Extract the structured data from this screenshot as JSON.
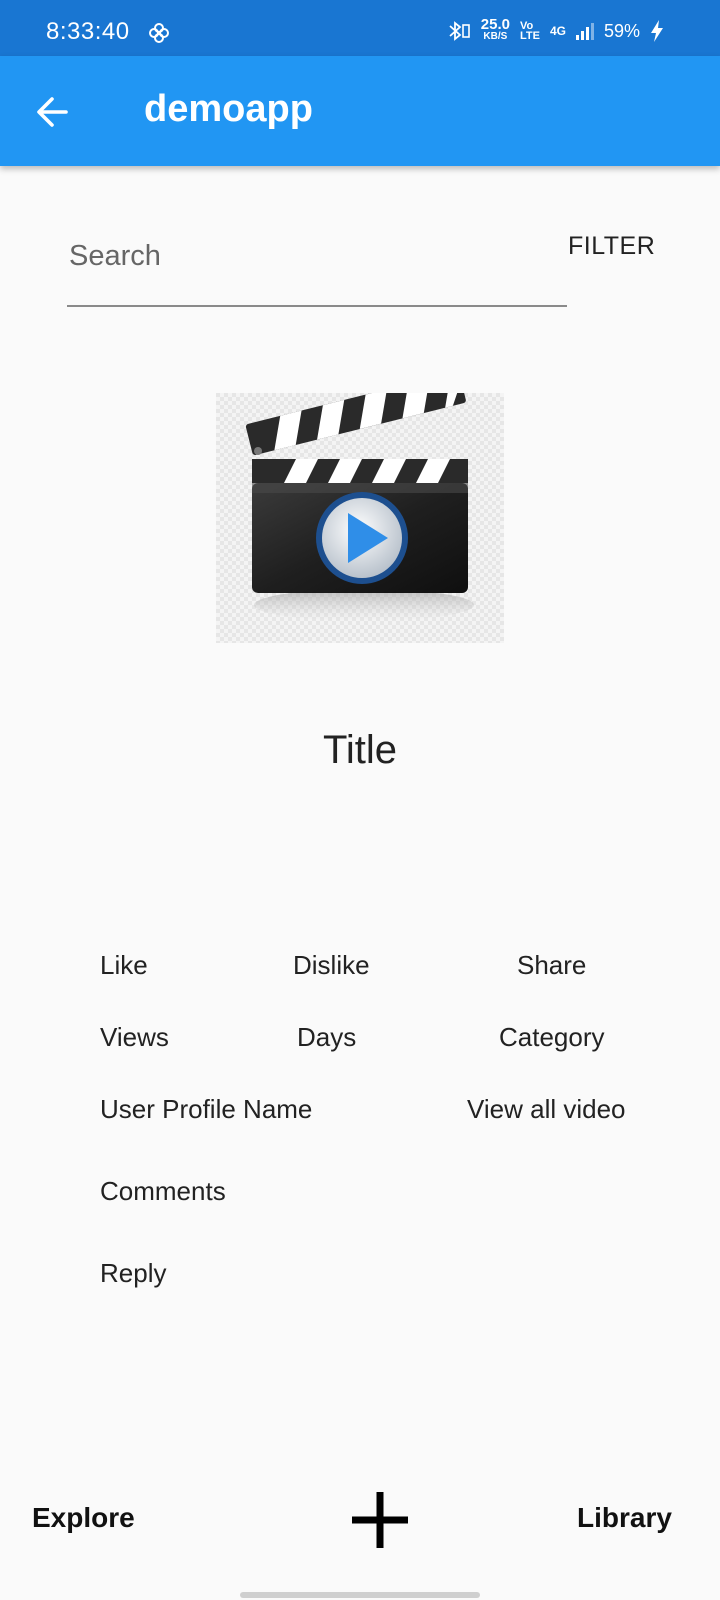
{
  "status_bar": {
    "time": "8:33:40",
    "pin_icon": "pinwheel-icon",
    "bluetooth_icon": "bluetooth-icon",
    "net_speed_value": "25.0",
    "net_speed_unit": "KB/S",
    "volte_top": "Vo",
    "volte_bottom": "LTE",
    "network_type": "4G",
    "signal_icon": "signal-icon",
    "battery": "59%",
    "charging_icon": "bolt-icon"
  },
  "app_bar": {
    "title": "demoapp",
    "back_icon": "arrow-back-icon",
    "background": "#2196f3",
    "status_background": "#1976d2"
  },
  "search": {
    "placeholder": "Search",
    "value": ""
  },
  "filter_label": "FILTER",
  "video": {
    "thumbnail_icon": "clapperboard-play-icon",
    "title": "Title"
  },
  "meta": {
    "like": "Like",
    "dislike": "Dislike",
    "share": "Share",
    "views": "Views",
    "days": "Days",
    "category": "Category",
    "user_profile_name": "User Profile Name",
    "view_all_video": "View all video",
    "comments": "Comments",
    "reply": "Reply"
  },
  "bottom_nav": {
    "explore": "Explore",
    "add_icon": "plus-icon",
    "library": "Library"
  },
  "colors": {
    "accent": "#2196f3",
    "play_blue": "#2f8ee8"
  }
}
